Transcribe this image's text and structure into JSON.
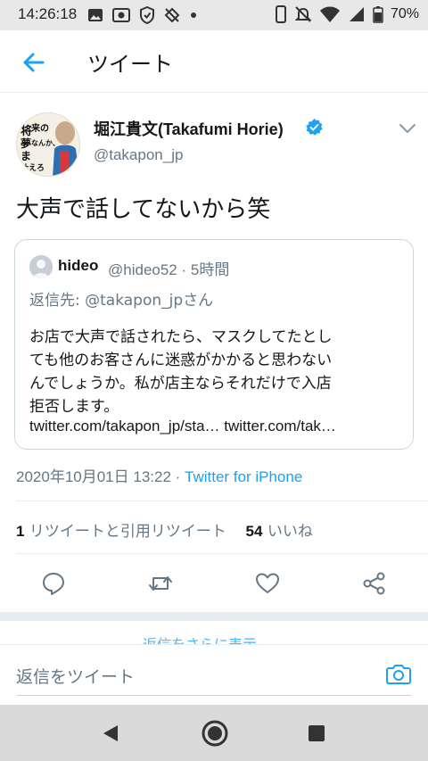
{
  "status_bar": {
    "time": "14:26:18",
    "battery": "70%",
    "icons_left": [
      "image-icon",
      "media-icon",
      "shield-icon",
      "location-off-icon",
      "dot-icon"
    ],
    "icons_right": [
      "phone-icon",
      "mute-icon",
      "wifi-icon",
      "signal-icon",
      "battery-icon"
    ]
  },
  "header": {
    "title": "ツイート",
    "back_icon": "arrow-left-icon"
  },
  "tweet": {
    "author_name": "堀江貴文(Takafumi Horie)",
    "author_handle": "@takapon_jp",
    "verified": true,
    "text": "大声で話してないから笑",
    "timestamp": "2020年10月01日 13:22",
    "separator": " · ",
    "source": "Twitter for iPhone",
    "retweet_count": "1",
    "retweet_label": "リツイートと引用リツイート",
    "like_count": "54",
    "like_label": "いいね"
  },
  "avatar_art": {
    "lines": [
      "将",
      "来の",
      "夢",
      "なんか、",
      "ま",
      "叶えろ"
    ]
  },
  "quoted_tweet": {
    "name": "hideo",
    "handle": "@hideo52",
    "time": " · 5時間",
    "reply_to": "返信先: @takapon_jpさん",
    "body_lines": [
      "お店で大声で話されたら、マスクしてたとし",
      "ても他のお客さんに迷惑がかかると思わない",
      "んでしょうか。私が店主ならそれだけで入店",
      "拒否します。"
    ],
    "links": "twitter.com/takapon_jp/sta… twitter.com/tak…"
  },
  "actions": [
    "reply-icon",
    "retweet-icon",
    "like-icon",
    "share-icon"
  ],
  "reply_bar": {
    "placeholder": "返信をツイート",
    "cutoff_text": "返信をさらに表示"
  },
  "colors": {
    "accent": "#1da1f2",
    "secondary_text": "#657786",
    "border": "#e6ecf0"
  }
}
